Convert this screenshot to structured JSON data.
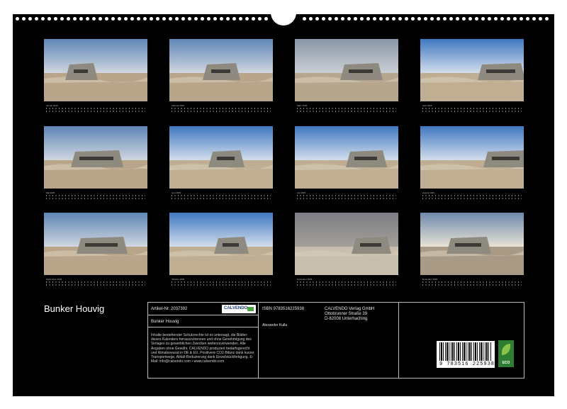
{
  "calendar": {
    "title": "Bunker Houvig",
    "months": [
      {
        "label": "Januar 2025",
        "scene": "sky-clouds"
      },
      {
        "label": "Februar 2025",
        "scene": "sky-clouds"
      },
      {
        "label": "März 2025",
        "scene": "overcast"
      },
      {
        "label": "April 2025",
        "scene": "blue-sky"
      },
      {
        "label": "Mai 2025",
        "scene": "sky-clouds"
      },
      {
        "label": "Juni 2025",
        "scene": "blue-sky"
      },
      {
        "label": "Juli 2025",
        "scene": "blue-sky"
      },
      {
        "label": "August 2025",
        "scene": "blue-sky"
      },
      {
        "label": "September 2025",
        "scene": "sky-clouds"
      },
      {
        "label": "Oktober 2025",
        "scene": "blue-sky"
      },
      {
        "label": "November 2025",
        "scene": "detail"
      },
      {
        "label": "Dezember 2025",
        "scene": "sunset"
      }
    ]
  },
  "info": {
    "article_label": "Artikel-Nr. 2037392",
    "publisher_logo": "CALVENDO",
    "product_title": "Bunker Houvig",
    "isbn": "ISBN 9783516225938",
    "author": "Alexander Kulla",
    "publisher_lines": [
      "CALVENDO Verlag GmbH",
      "Ottobrunner Straße 39",
      "D-82008 Unterhaching"
    ],
    "notice": "Inhalte bestehender Schutzrechte ist es untersagt, die Blätter dieses Kalenders herauszutrennen und ohne Genehmigung des Verlages zu gewerblichen Zwecken weiterzuverwenden. Alle Angaben ohne Gewähr. CALVENDO produziert bedarfsgerecht und klimabewusst in DE & EU. Positivere CO2-Bilanz dank kurzer Transportwege, Abfall-Reduzierung dank Einzelstückfertigung. E-Mail: info@calvendo.com • www.calvendo.com",
    "barcode_number": "9 783516 225938",
    "eco_label": "ECO"
  },
  "colors": {
    "sheet": "#000000",
    "border": "#bfbfbf",
    "logo_text": "#1a3d7c",
    "eco": "#2e7d32"
  }
}
